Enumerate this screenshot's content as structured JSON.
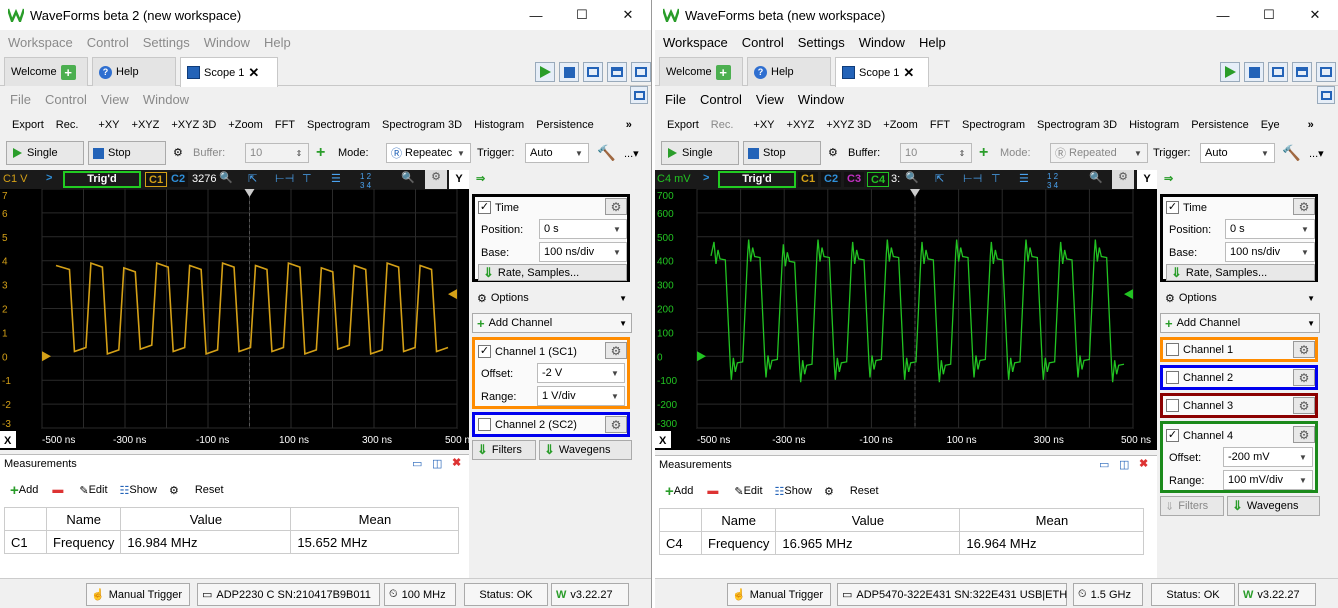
{
  "w1": {
    "title": "WaveForms beta 2 (new workspace)",
    "menu": [
      "Workspace",
      "Control",
      "Settings",
      "Window",
      "Help"
    ],
    "tabs": {
      "welcome": "Welcome",
      "help": "Help",
      "scope": "Scope 1"
    },
    "scope_menu": [
      "File",
      "Control",
      "View",
      "Window"
    ],
    "toolbar": [
      "Export",
      "Rec.",
      "+XY",
      "+XYZ",
      "+XYZ 3D",
      "+Zoom",
      "FFT",
      "Spectrogram",
      "Spectrogram 3D",
      "Histogram",
      "Persistence"
    ],
    "single": "Single",
    "stop": "Stop",
    "buffer_label": "Buffer:",
    "buffer_value": "10",
    "mode_label": "Mode:",
    "mode_value": "Repeatec",
    "trigger_label": "Trigger:",
    "trigger_value": "Auto",
    "chan_label": "C1 V",
    "trig_status": "Trig'd",
    "c1": "C1",
    "c2": "C2",
    "samples": "3276",
    "y_ticks": [
      "7",
      "6",
      "5",
      "4",
      "3",
      "2",
      "1",
      "0",
      "-1",
      "-2",
      "-3"
    ],
    "x_ticks": [
      "-500 ns",
      "-300 ns",
      "-100 ns",
      "100 ns",
      "300 ns",
      "500 ns"
    ],
    "x_btn": "X",
    "y_btn": "Y",
    "measurements": {
      "title": "Measurements",
      "add": "Add",
      "edit": "Edit",
      "show": "Show",
      "reset": "Reset",
      "headers": [
        "Name",
        "Value",
        "Mean"
      ],
      "row": {
        "ch": "C1",
        "name": "Frequency",
        "value": "16.984 MHz",
        "mean": "15.652 MHz"
      }
    },
    "time": {
      "label": "Time",
      "position_label": "Position:",
      "position": "0 s",
      "base_label": "Base:",
      "base": "100 ns/div",
      "rate": "Rate, Samples..."
    },
    "options": "Options",
    "add_channel": "Add Channel",
    "ch1": {
      "label": "Channel 1 (SC1)",
      "offset_label": "Offset:",
      "offset": "-2 V",
      "range_label": "Range:",
      "range": "1 V/div"
    },
    "ch2": {
      "label": "Channel 2 (SC2)"
    },
    "filters": "Filters",
    "wavegens": "Wavegens",
    "status": {
      "trigger": "Manual Trigger",
      "device": "ADP2230 C SN:210417B9B011",
      "freq": "100 MHz",
      "status": "Status: OK",
      "version": "v3.22.27"
    }
  },
  "w2": {
    "title": "WaveForms beta (new workspace)",
    "menu": [
      "Workspace",
      "Control",
      "Settings",
      "Window",
      "Help"
    ],
    "tabs": {
      "welcome": "Welcome",
      "help": "Help",
      "scope": "Scope 1"
    },
    "scope_menu": [
      "File",
      "Control",
      "View",
      "Window"
    ],
    "toolbar": [
      "Export",
      "Rec.",
      "+XY",
      "+XYZ",
      "+XYZ 3D",
      "+Zoom",
      "FFT",
      "Spectrogram",
      "Spectrogram 3D",
      "Histogram",
      "Persistence",
      "Eye"
    ],
    "single": "Single",
    "stop": "Stop",
    "buffer_label": "Buffer:",
    "buffer_value": "10",
    "mode_label": "Mode:",
    "mode_value": "Repeated",
    "trigger_label": "Trigger:",
    "trigger_value": "Auto",
    "chan_label": "C4 mV",
    "trig_status": "Trig'd",
    "c1": "C1",
    "c2": "C2",
    "c3": "C3",
    "c4": "C4",
    "samples": "3:",
    "y_ticks": [
      "700",
      "600",
      "500",
      "400",
      "300",
      "200",
      "100",
      "0",
      "-100",
      "-200",
      "-300"
    ],
    "x_ticks": [
      "-500 ns",
      "-300 ns",
      "-100 ns",
      "100 ns",
      "300 ns",
      "500 ns"
    ],
    "x_btn": "X",
    "y_btn": "Y",
    "measurements": {
      "title": "Measurements",
      "add": "Add",
      "edit": "Edit",
      "show": "Show",
      "reset": "Reset",
      "headers": [
        "Name",
        "Value",
        "Mean"
      ],
      "row": {
        "ch": "C4",
        "name": "Frequency",
        "value": "16.965 MHz",
        "mean": "16.964 MHz"
      }
    },
    "time": {
      "label": "Time",
      "position_label": "Position:",
      "position": "0 s",
      "base_label": "Base:",
      "base": "100 ns/div",
      "rate": "Rate, Samples..."
    },
    "options": "Options",
    "add_channel": "Add Channel",
    "ch1": {
      "label": "Channel 1"
    },
    "ch2": {
      "label": "Channel 2"
    },
    "ch3": {
      "label": "Channel 3"
    },
    "ch4": {
      "label": "Channel 4",
      "offset_label": "Offset:",
      "offset": "-200 mV",
      "range_label": "Range:",
      "range": "100 mV/div"
    },
    "filters": "Filters",
    "wavegens": "Wavegens",
    "status": {
      "trigger": "Manual Trigger",
      "device": "ADP5470-322E431 SN:322E431 USB|ETH",
      "freq": "1.5 GHz",
      "status": "Status: OK",
      "version": "v3.22.27"
    }
  },
  "colors": {
    "c1": "#d4a017",
    "c2": "#2f8fd8",
    "c3": "#c030c0",
    "c4": "#22c322",
    "orange": "#ff8c00",
    "blue": "#0000ee",
    "maroon": "#8b0000",
    "green": "#1b8a1b"
  },
  "chart_data": [
    {
      "type": "line",
      "series": [
        {
          "values": [
            3.8,
            0.2,
            3.9,
            0.1,
            3.7,
            0.3,
            3.9,
            0.2,
            3.8,
            0.1,
            3.9,
            0.2,
            3.8,
            0.2,
            3.9,
            0.1,
            3.7,
            0.3,
            3.8,
            0.1,
            3.9,
            0.2,
            3.8,
            0.2
          ]
        }
      ],
      "xlim": [
        -500,
        500
      ],
      "ylim": [
        -3,
        7
      ],
      "x_unit": "ns"
    },
    {
      "type": "line",
      "series": [
        {
          "values": [
            420,
            -40,
            430,
            -30,
            410,
            -50,
            430,
            -40,
            420,
            -30,
            430,
            -40,
            420,
            -50,
            430,
            -30,
            420,
            -40,
            430,
            -40,
            420,
            -30,
            430,
            -50
          ]
        }
      ],
      "xlim": [
        -500,
        500
      ],
      "ylim": [
        -300,
        700
      ],
      "x_unit": "ns"
    }
  ]
}
